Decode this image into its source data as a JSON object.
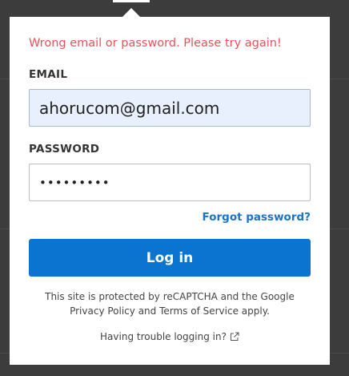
{
  "login_form": {
    "error_message": "Wrong email or password. Please try again!",
    "email_label": "EMAIL",
    "email_value": "ahorucom@gmail.com",
    "password_label": "PASSWORD",
    "password_value": "•••••••••",
    "forgot_password": "Forgot password?",
    "login_button": "Log in",
    "recaptcha_notice": "This site is protected by reCAPTCHA and the Google Privacy Policy and Terms of Service apply.",
    "trouble_link": "Having trouble logging in?",
    "trouble_icon": "external-link-icon"
  },
  "colors": {
    "error": "#e8505b",
    "accent": "#0a74d0",
    "link": "#1a73c8",
    "email_field_bg": "#e8f0fe",
    "overlay_bg": "#3a3a3a"
  }
}
